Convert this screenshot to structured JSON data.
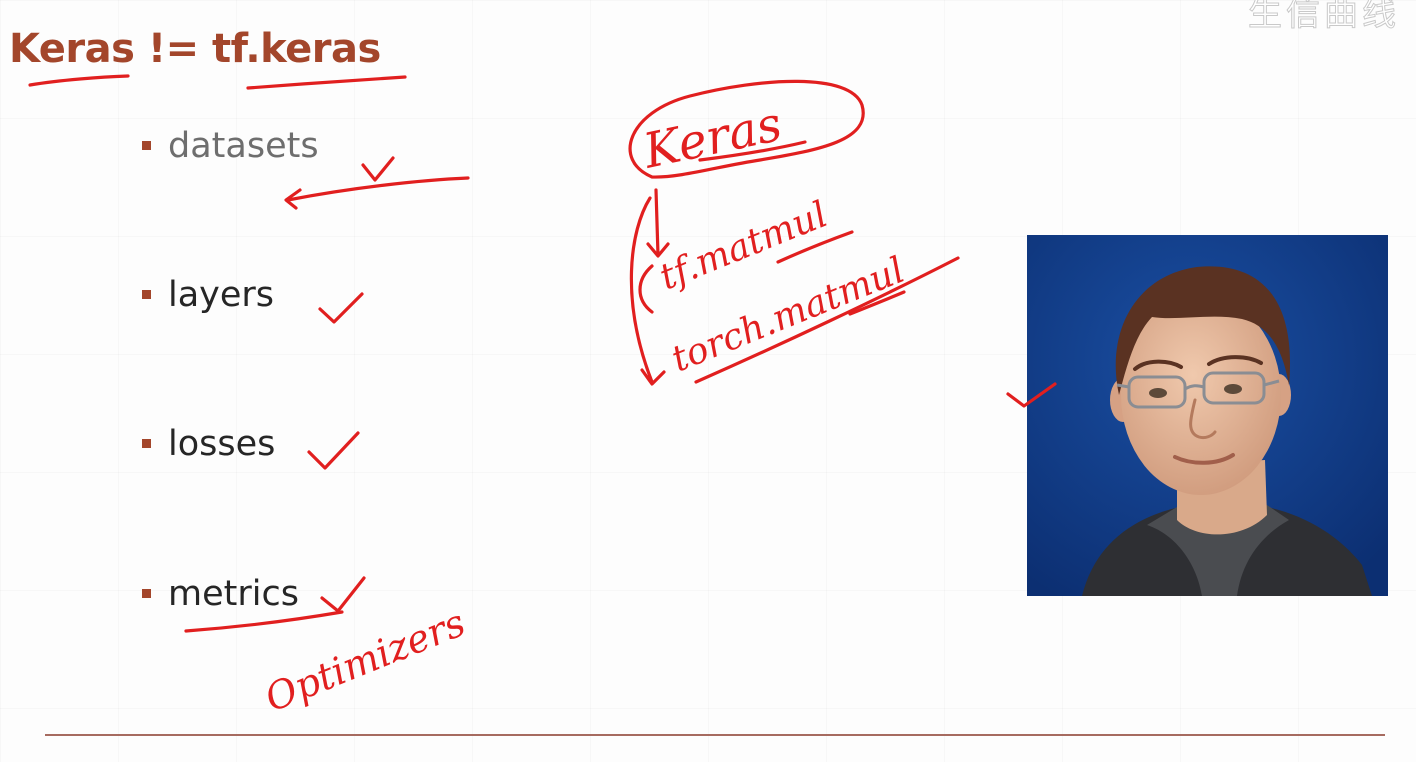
{
  "slide": {
    "title": "Keras != tf.keras",
    "watermark": "生信曲线",
    "accent_color": "#a3462b",
    "ink_color": "#e11f1f",
    "bullets": [
      {
        "label": "datasets",
        "muted": true
      },
      {
        "label": "layers",
        "muted": false
      },
      {
        "label": "losses",
        "muted": false
      },
      {
        "label": "metrics",
        "muted": false
      }
    ]
  },
  "annotations": {
    "keras": "Keras",
    "tf_matmul": "tf.matmul",
    "torch_matmul": "torch.matmul",
    "optimizers": "Optimizers"
  }
}
